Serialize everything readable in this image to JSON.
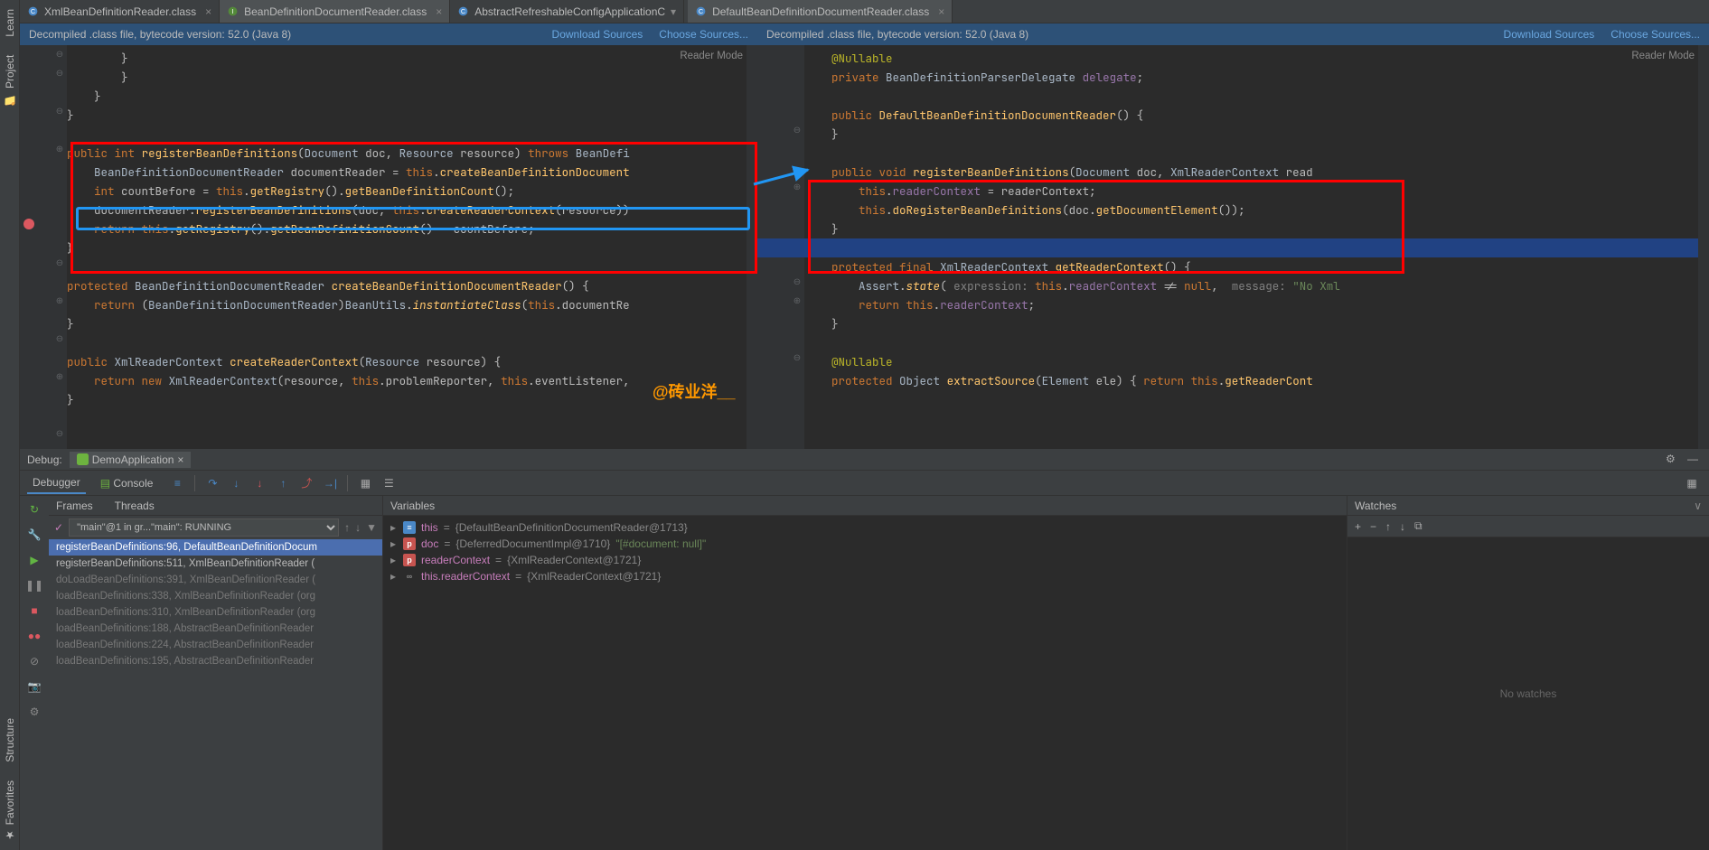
{
  "sidebar_left": {
    "learn": "Learn",
    "project": "Project",
    "structure": "Structure",
    "favorites": "Favorites"
  },
  "tabs": [
    {
      "label": "XmlBeanDefinitionReader.class",
      "active": false
    },
    {
      "label": "BeanDefinitionDocumentReader.class",
      "active": true
    },
    {
      "label": "AbstractRefreshableConfigApplicationC",
      "active": false,
      "dropdown": true
    },
    {
      "label": "DefaultBeanDefinitionDocumentReader.class",
      "active": true
    }
  ],
  "infobar": {
    "msg": "Decompiled .class file, bytecode version: 52.0 (Java 8)",
    "download": "Download Sources",
    "choose": "Choose Sources..."
  },
  "reader_mode": "Reader Mode",
  "watermark": "@砖业洋__",
  "debug": {
    "title": "Debug:",
    "run_config": "DemoApplication",
    "debugger_tab": "Debugger",
    "console_tab": "Console",
    "frames": "Frames",
    "threads": "Threads",
    "thread_sel": "\"main\"@1 in gr...\"main\": RUNNING",
    "variables": "Variables",
    "watches": "Watches",
    "no_watches": "No watches",
    "stack": [
      {
        "txt": "registerBeanDefinitions:96, DefaultBeanDefinitionDocum",
        "sel": true
      },
      {
        "txt": "registerBeanDefinitions:511, XmlBeanDefinitionReader (",
        "near": true
      },
      {
        "txt": "doLoadBeanDefinitions:391, XmlBeanDefinitionReader ("
      },
      {
        "txt": "loadBeanDefinitions:338, XmlBeanDefinitionReader (org"
      },
      {
        "txt": "loadBeanDefinitions:310, XmlBeanDefinitionReader (org"
      },
      {
        "txt": "loadBeanDefinitions:188, AbstractBeanDefinitionReader"
      },
      {
        "txt": "loadBeanDefinitions:224, AbstractBeanDefinitionReader"
      },
      {
        "txt": "loadBeanDefinitions:195, AbstractBeanDefinitionReader"
      }
    ],
    "vars": [
      {
        "ico": "≡",
        "icobg": "#4a88c7",
        "name": "this",
        "val": "{DefaultBeanDefinitionDocumentReader@1713}"
      },
      {
        "ico": "p",
        "icobg": "#c75450",
        "name": "doc",
        "val": "{DeferredDocumentImpl@1710} ",
        "str": "\"[#document: null]\""
      },
      {
        "ico": "p",
        "icobg": "#c75450",
        "name": "readerContext",
        "val": "{XmlReaderContext@1721}"
      },
      {
        "ico": "∞",
        "icobg": "#3c3f41",
        "name": "this.readerContext",
        "val": "{XmlReaderContext@1721}"
      }
    ]
  }
}
